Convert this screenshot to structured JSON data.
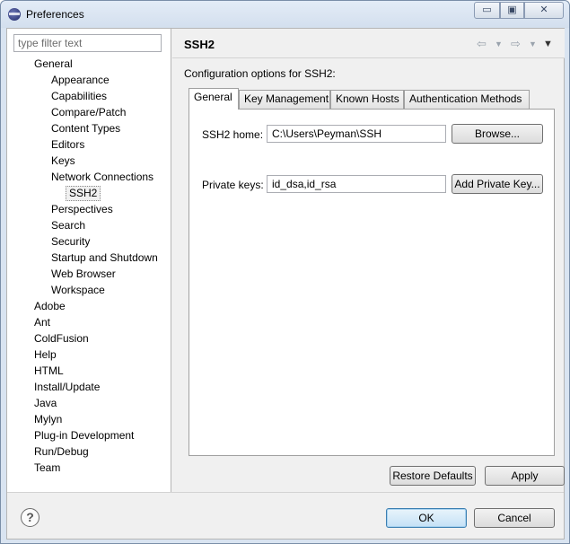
{
  "window": {
    "title": "Preferences",
    "controls": {
      "minimize": "▭",
      "maximize": "▣",
      "close": "✕"
    }
  },
  "filter": {
    "placeholder": "type filter text",
    "value": ""
  },
  "tree": {
    "items": [
      {
        "label": "General",
        "level": 0
      },
      {
        "label": "Appearance",
        "level": 1
      },
      {
        "label": "Capabilities",
        "level": 1
      },
      {
        "label": "Compare/Patch",
        "level": 1
      },
      {
        "label": "Content Types",
        "level": 1
      },
      {
        "label": "Editors",
        "level": 1
      },
      {
        "label": "Keys",
        "level": 1
      },
      {
        "label": "Network Connections",
        "level": 1
      },
      {
        "label": "SSH2",
        "level": 2,
        "selected": true
      },
      {
        "label": "Perspectives",
        "level": 1
      },
      {
        "label": "Search",
        "level": 1
      },
      {
        "label": "Security",
        "level": 1
      },
      {
        "label": "Startup and Shutdown",
        "level": 1
      },
      {
        "label": "Web Browser",
        "level": 1
      },
      {
        "label": "Workspace",
        "level": 1
      },
      {
        "label": "Adobe",
        "level": 0
      },
      {
        "label": "Ant",
        "level": 0
      },
      {
        "label": "ColdFusion",
        "level": 0
      },
      {
        "label": "Help",
        "level": 0
      },
      {
        "label": "HTML",
        "level": 0
      },
      {
        "label": "Install/Update",
        "level": 0
      },
      {
        "label": "Java",
        "level": 0
      },
      {
        "label": "Mylyn",
        "level": 0
      },
      {
        "label": "Plug-in Development",
        "level": 0
      },
      {
        "label": "Run/Debug",
        "level": 0
      },
      {
        "label": "Team",
        "level": 0
      }
    ]
  },
  "page": {
    "title": "SSH2",
    "description": "Configuration options for SSH2:",
    "nav_icons": {
      "back": "⇦",
      "forward": "⇨",
      "dropdown": "▼",
      "view_menu": "▼"
    }
  },
  "tabs": [
    {
      "label": "General",
      "active": true
    },
    {
      "label": "Key Management",
      "active": false
    },
    {
      "label": "Known Hosts",
      "active": false
    },
    {
      "label": "Authentication Methods",
      "active": false
    }
  ],
  "general": {
    "ssh2_home_label": "SSH2 home:",
    "ssh2_home_value": "C:\\Users\\Peyman\\SSH",
    "browse_label": "Browse...",
    "private_keys_label": "Private keys:",
    "private_keys_value": "id_dsa,id_rsa",
    "add_private_key_label": "Add Private Key..."
  },
  "buttons": {
    "restore_defaults": "Restore Defaults",
    "apply": "Apply",
    "ok": "OK",
    "cancel": "Cancel"
  },
  "help_icon": "?"
}
